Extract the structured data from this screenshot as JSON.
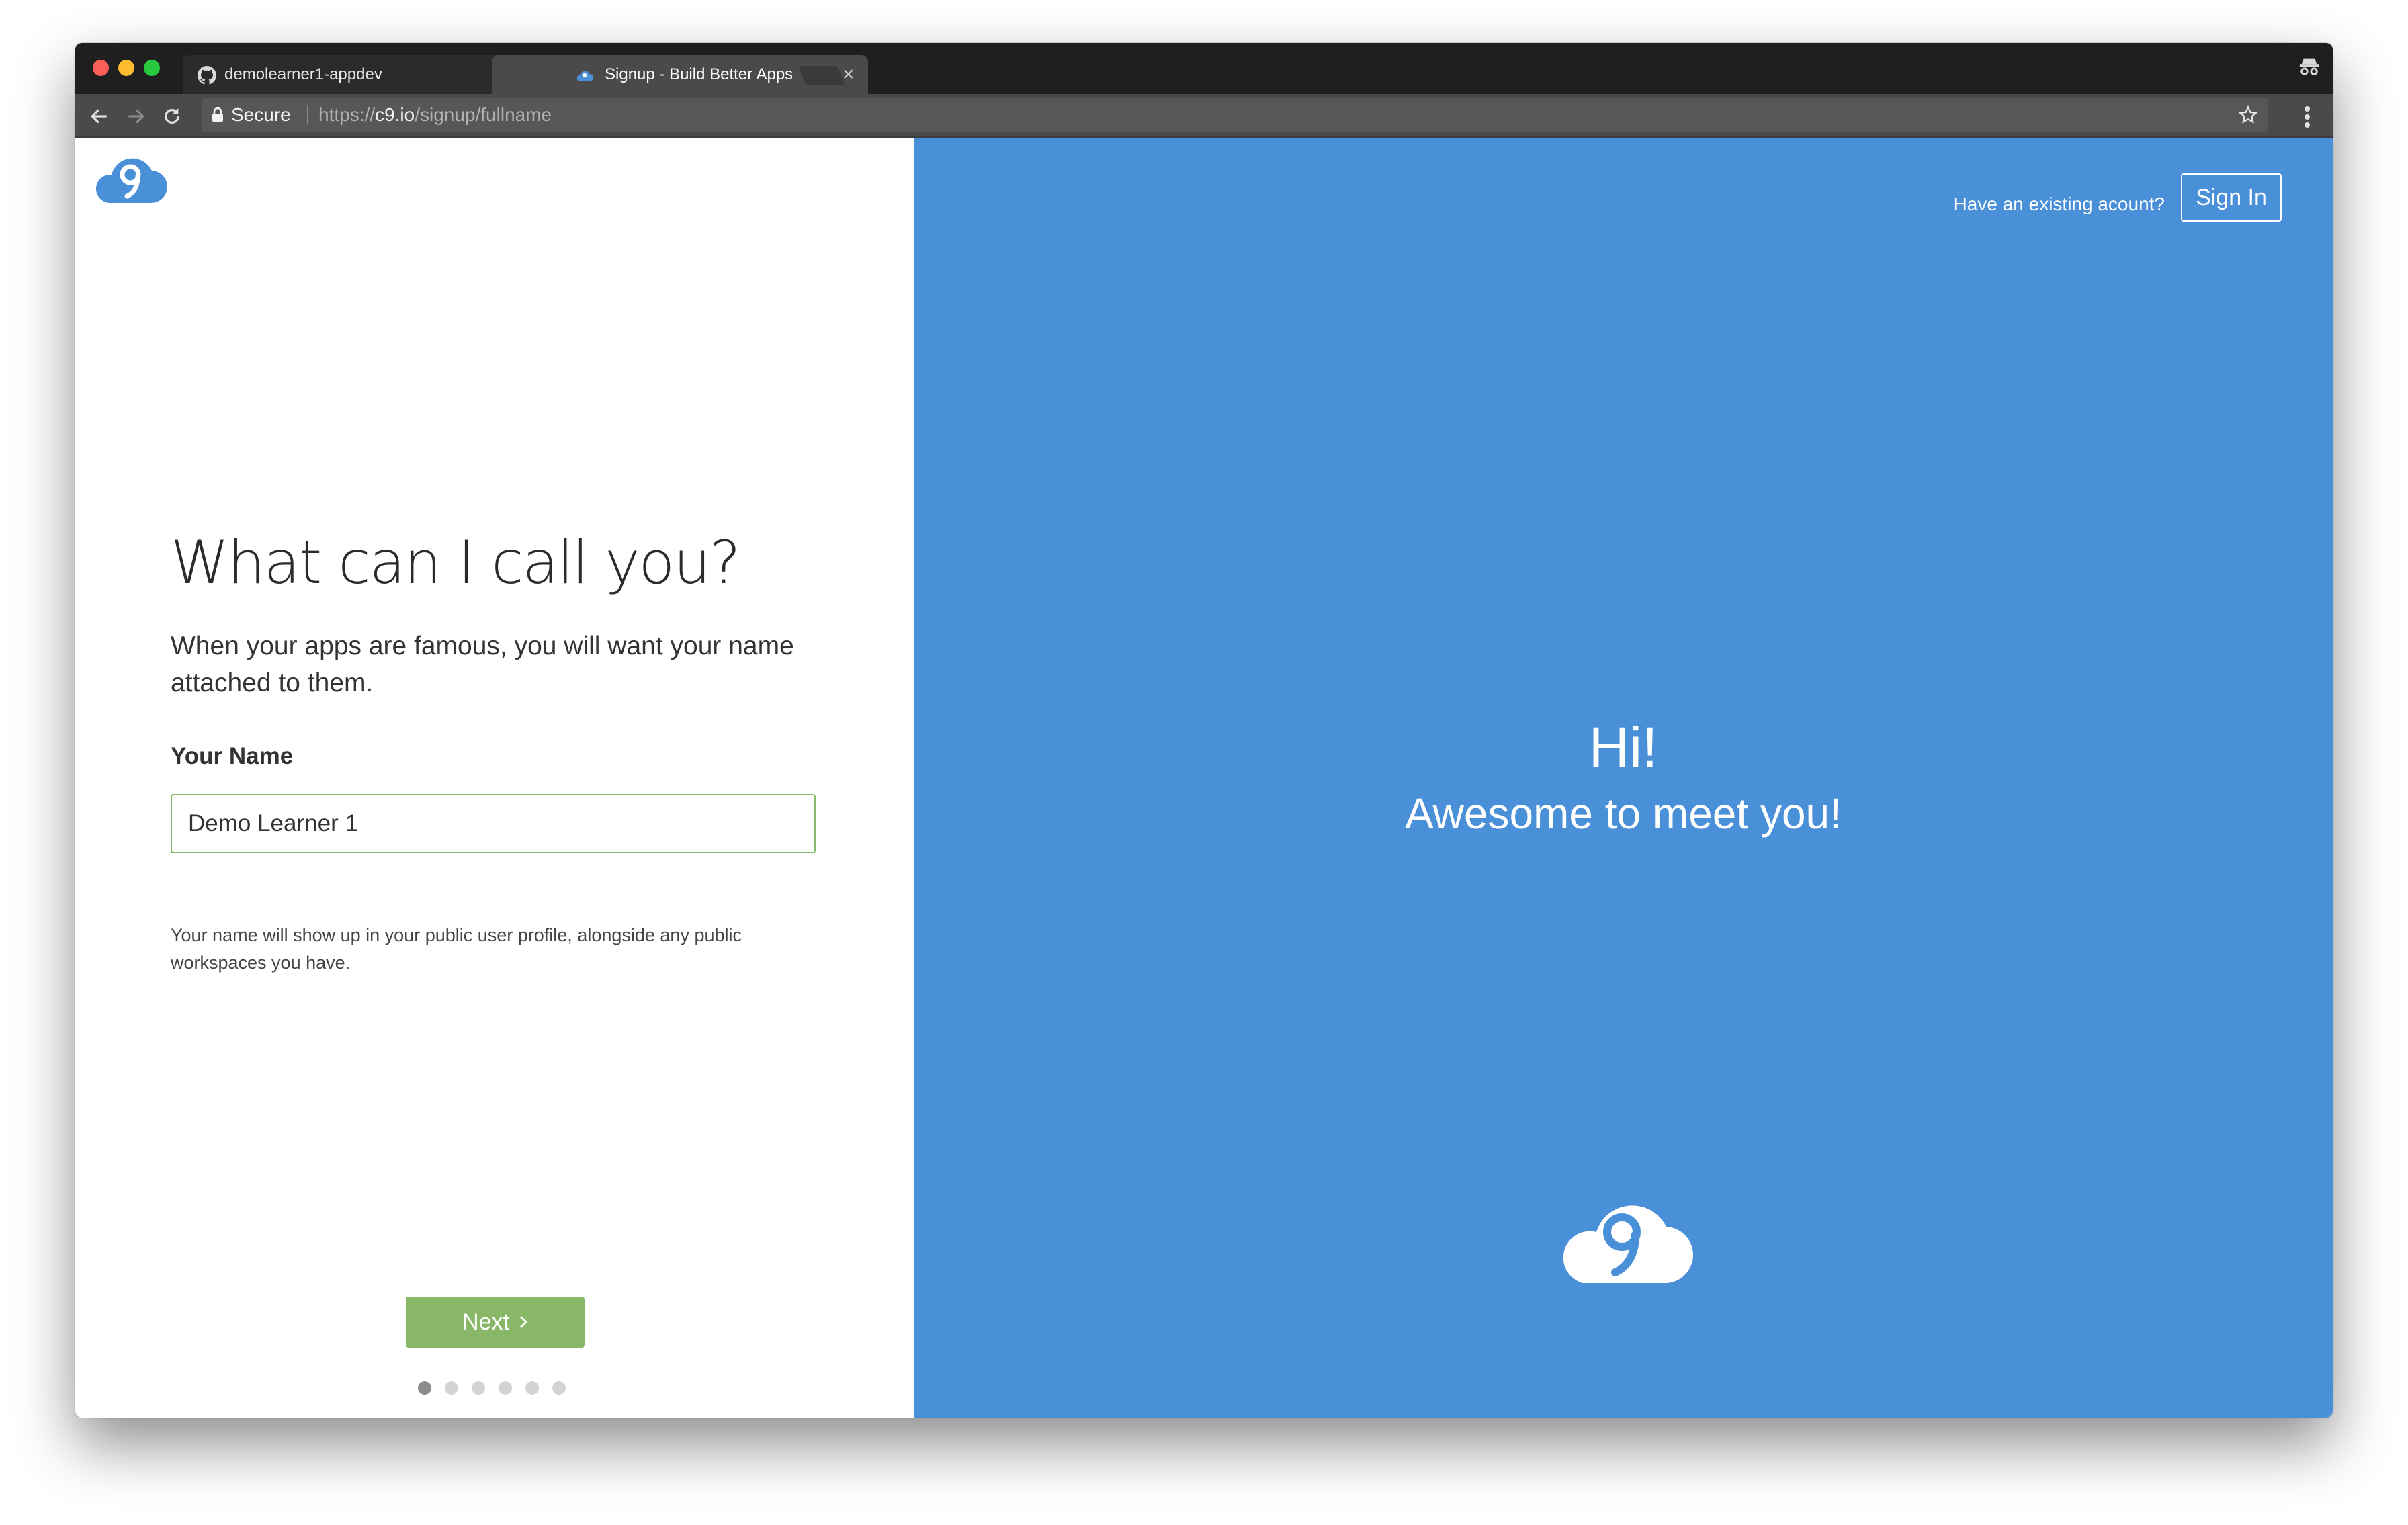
{
  "browser": {
    "tabs": [
      {
        "title": "demolearner1-appdev",
        "favicon": "github-icon",
        "active": false
      },
      {
        "title": "Signup - Build Better Apps",
        "favicon": "cloud9-icon",
        "active": true
      }
    ],
    "secure_label": "Secure",
    "url_scheme": "https://",
    "url_host": "c9.io",
    "url_path": "/signup/fullname"
  },
  "signup": {
    "heading": "What can I call you?",
    "intro": "When your apps are famous, you will want your name attached to them.",
    "name_label": "Your Name",
    "name_value": "Demo Learner 1",
    "help_text": "Your name will show up in your public user profile, alongside any public workspaces you have.",
    "next_label": "Next",
    "steps_total": 6,
    "current_step": 1
  },
  "aside": {
    "existing_account_question": "Have an existing acount?",
    "sign_in_label": "Sign In",
    "greeting": "Hi!",
    "subgreeting": "Awesome to meet you!"
  },
  "colors": {
    "right_pane": "#4a90d9",
    "next_button": "#88b767",
    "input_border": "#83bb6a",
    "logo_blue": "#4a90d9"
  }
}
